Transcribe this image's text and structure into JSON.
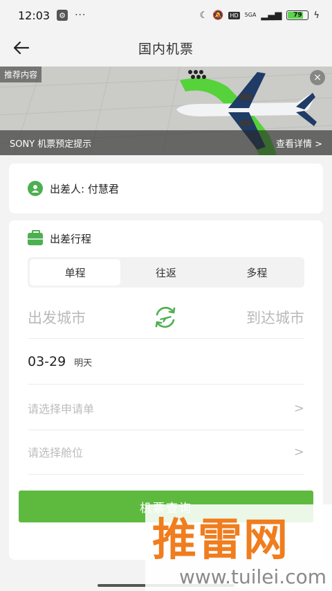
{
  "status_bar": {
    "time": "12:03",
    "dots": "···",
    "hd": "HD",
    "network": "5GA",
    "battery": "79",
    "battery_level": 0.79
  },
  "nav": {
    "title": "国内机票"
  },
  "banner": {
    "tag": "推荐内容",
    "caption": "SONY 机票预定提示",
    "link": "查看详情 >",
    "close_symbol": "×"
  },
  "traveler": {
    "text": "出差人: 付慧君"
  },
  "trip": {
    "title": "出差行程",
    "tabs": [
      {
        "label": "单程",
        "active": true
      },
      {
        "label": "往返",
        "active": false
      },
      {
        "label": "多程",
        "active": false
      }
    ],
    "from_placeholder": "出发城市",
    "to_placeholder": "到达城市",
    "date": "03-29",
    "date_note": "明天",
    "application_placeholder": "请选择申请单",
    "cabin_placeholder": "请选择舱位",
    "chevron": ">",
    "search_label": "机票查询"
  },
  "watermark": {
    "text": "推雷网",
    "url": "www.tuilei.com"
  },
  "colors": {
    "accent": "#5dba3f",
    "icon_green": "#4caf50",
    "placeholder": "#bcbcbc",
    "watermark": "#f07d1e"
  }
}
